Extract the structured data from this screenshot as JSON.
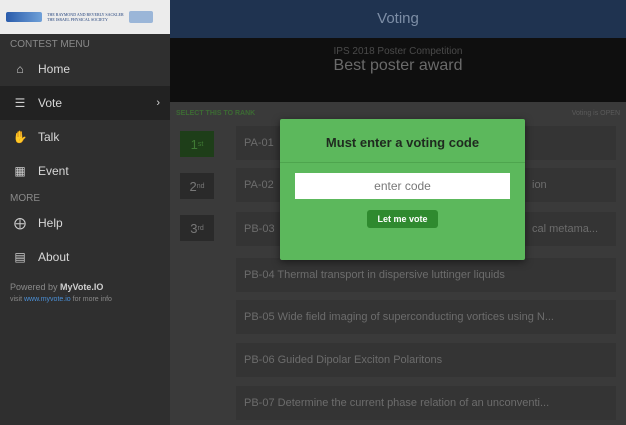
{
  "sidebar": {
    "contest_menu_label": "CONTEST MENU",
    "more_label": "MORE",
    "items": [
      {
        "label": "Home",
        "icon": "home-icon"
      },
      {
        "label": "Vote",
        "icon": "list-icon"
      },
      {
        "label": "Talk",
        "icon": "thumbs-up-icon"
      },
      {
        "label": "Event",
        "icon": "calendar-icon"
      },
      {
        "label": "Help",
        "icon": "lifebuoy-icon"
      },
      {
        "label": "About",
        "icon": "document-icon"
      }
    ],
    "powered_prefix": "Powered by ",
    "powered_brand": "MyVote.IO",
    "visit_prefix": "visit ",
    "visit_link": "www.myvote.io",
    "visit_suffix": " for more info"
  },
  "topbar": {
    "title": "Voting"
  },
  "banner": {
    "competition": "IPS 2018 Poster Competition",
    "award": "Best poster award"
  },
  "subhead": {
    "select_hint": "SELECT THIS TO RANK",
    "voting_status": "Voting is OPEN"
  },
  "ranks": [
    {
      "num": "1",
      "suffix": "st"
    },
    {
      "num": "2",
      "suffix": "nd"
    },
    {
      "num": "3",
      "suffix": "rd"
    }
  ],
  "posters": [
    "PA-01",
    "PA-02",
    "PB-03",
    "PB-04 Thermal transport in dispersive luttinger liquids",
    "PB-05 Wide field imaging of superconducting vortices using N...",
    "PB-06 Guided Dipolar Exciton Polaritons",
    "PB-07 Determine the current phase relation of an unconventi..."
  ],
  "poster_tails": [
    "",
    "ion",
    "cal metama..."
  ],
  "modal": {
    "title": "Must enter a voting code",
    "placeholder": "enter code",
    "button": "Let me vote"
  }
}
